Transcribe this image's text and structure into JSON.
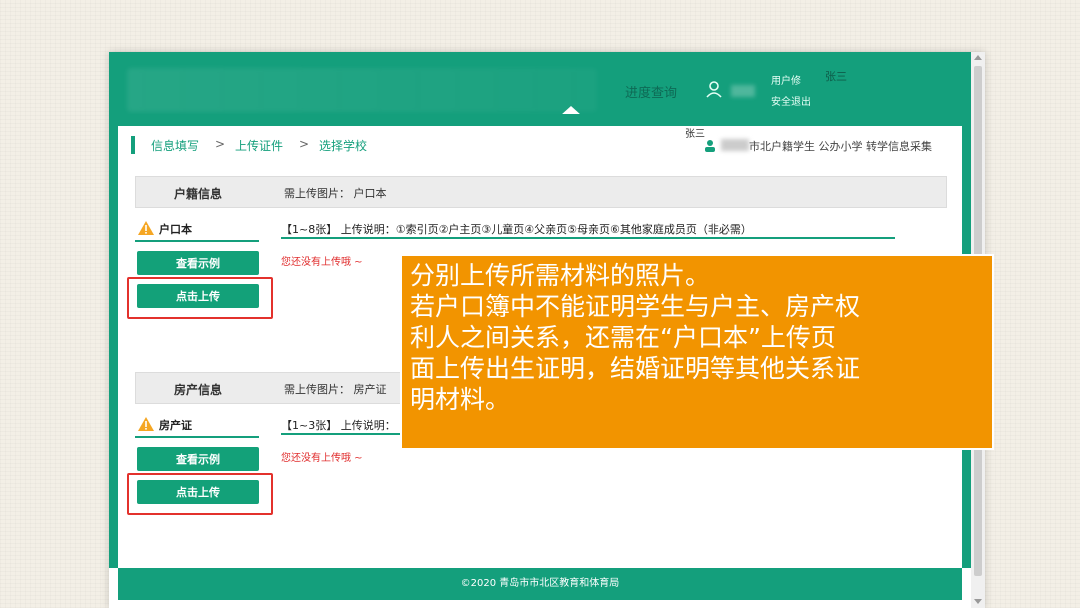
{
  "header": {
    "progress_query": "进度查询",
    "user_label": "用户修",
    "user_name": "张三",
    "logout": "安全退出"
  },
  "breadcrumb": {
    "items": [
      "信息填写",
      "上传证件",
      "选择学校"
    ],
    "separator": ">"
  },
  "user_corner": {
    "name": "张三",
    "info": "市北户籍学生 公办小学 转学信息采集"
  },
  "sections": [
    {
      "title": "户籍信息",
      "required": "需上传图片：  户口本",
      "doc_label": "户口本",
      "upload_desc": "【1~8张】 上传说明：①索引页②户主页③儿童页④父亲页⑤母亲页⑥其他家庭成员页（非必需）",
      "status": "您还没有上传哦 ~",
      "view_example": "查看示例",
      "upload": "点击上传"
    },
    {
      "title": "房产信息",
      "required": "需上传图片：  房产证",
      "doc_label": "房产证",
      "upload_desc": "【1~3张】 上传说明：",
      "status": "您还没有上传哦 ~",
      "view_example": "查看示例",
      "upload": "点击上传"
    }
  ],
  "footer": "©2020 青岛市市北区教育和体育局",
  "callout": {
    "lines": [
      "分别上传所需材料的照片。",
      "若户口簿中不能证明学生与户主、房产权",
      "利人之间关系，还需在“户口本”上传页",
      "面上传出生证明，结婚证明等其他关系证",
      "明材料。"
    ]
  },
  "colors": {
    "primary_green": "#149f7c",
    "callout_orange": "#f29400",
    "highlight_red": "#e3312c",
    "warning_text": "#e02d2d"
  }
}
